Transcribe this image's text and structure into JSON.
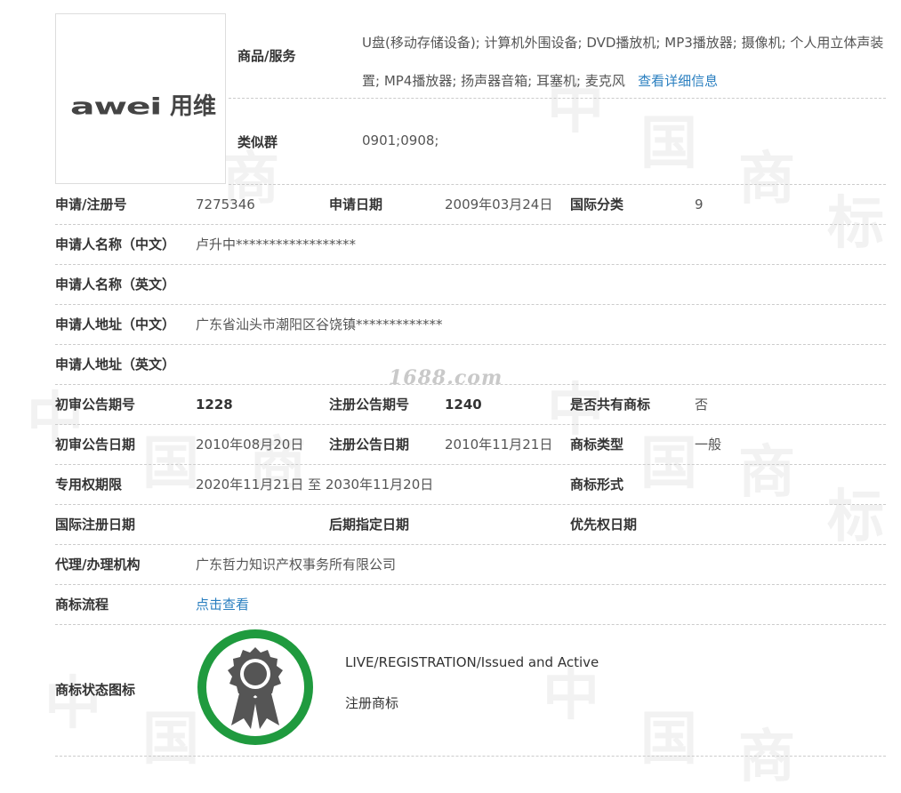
{
  "logo": {
    "latin": "awei",
    "chinese": "用维"
  },
  "goods": {
    "label": "商品/服务",
    "text": "U盘(移动存储设备); 计算机外围设备; DVD播放机; MP3播放器; 摄像机; 个人用立体声装置; MP4播放器; 扬声器音箱; 耳塞机; 麦克风",
    "link": "查看详细信息"
  },
  "similar": {
    "label": "类似群",
    "value": "0901;0908;"
  },
  "rows": {
    "reg_no": {
      "label": "申请/注册号",
      "value": "7275346"
    },
    "app_date": {
      "label": "申请日期",
      "value": "2009年03月24日"
    },
    "intl_class": {
      "label": "国际分类",
      "value": "9"
    },
    "applicant_cn": {
      "label": "申请人名称（中文）",
      "value": "卢升中******************"
    },
    "applicant_en": {
      "label": "申请人名称（英文）",
      "value": ""
    },
    "address_cn": {
      "label": "申请人地址（中文）",
      "value": "广东省汕头市潮阳区谷饶镇*************"
    },
    "address_en": {
      "label": "申请人地址（英文）",
      "value": ""
    },
    "prelim_no": {
      "label": "初审公告期号",
      "value": "1228"
    },
    "reg_pub_no": {
      "label": "注册公告期号",
      "value": "1240"
    },
    "shared": {
      "label": "是否共有商标",
      "value": "否"
    },
    "prelim_date": {
      "label": "初审公告日期",
      "value": "2010年08月20日"
    },
    "reg_pub_date": {
      "label": "注册公告日期",
      "value": "2010年11月21日"
    },
    "tm_type": {
      "label": "商标类型",
      "value": "一般"
    },
    "term": {
      "label": "专用权期限",
      "value": "2020年11月21日 至 2030年11月20日"
    },
    "tm_form": {
      "label": "商标形式",
      "value": ""
    },
    "intl_reg_date": {
      "label": "国际注册日期",
      "value": ""
    },
    "later_date": {
      "label": "后期指定日期",
      "value": ""
    },
    "priority_date": {
      "label": "优先权日期",
      "value": ""
    },
    "agent": {
      "label": "代理/办理机构",
      "value": "广东哲力知识产权事务所有限公司"
    },
    "process": {
      "label": "商标流程",
      "value": "点击查看"
    }
  },
  "status": {
    "label": "商标状态图标",
    "english": "LIVE/REGISTRATION/Issued and Active",
    "chinese": "注册商标"
  },
  "watermark": {
    "site": "1688.com",
    "chars": [
      "中",
      "国",
      "商",
      "标"
    ]
  },
  "colors": {
    "link": "#2a7fc0",
    "badge_ring": "#1f9a3e",
    "badge_icon": "#555555",
    "divider": "#cccccc"
  }
}
